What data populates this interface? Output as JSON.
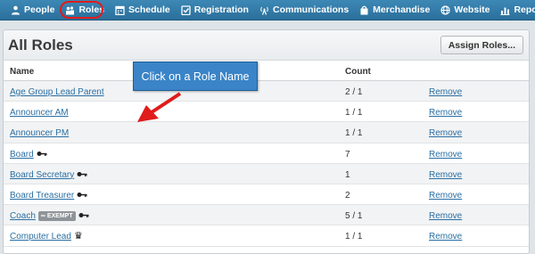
{
  "nav": {
    "items": [
      {
        "label": "People",
        "icon": "person-icon"
      },
      {
        "label": "Roles",
        "icon": "roles-icon"
      },
      {
        "label": "Schedule",
        "icon": "calendar-icon"
      },
      {
        "label": "Registration",
        "icon": "checkbox-icon"
      },
      {
        "label": "Communications",
        "icon": "broadcast-icon"
      },
      {
        "label": "Merchandise",
        "icon": "bag-icon"
      },
      {
        "label": "Website",
        "icon": "globe-icon"
      },
      {
        "label": "Reports",
        "icon": "bar-chart-icon"
      }
    ],
    "active": "Roles"
  },
  "panel": {
    "title": "All Roles",
    "assign_label": "Assign Roles..."
  },
  "table": {
    "headers": {
      "name": "Name",
      "count": "Count"
    },
    "rows": [
      {
        "name": "Age Group Lead Parent",
        "count": "2 / 1",
        "action": "Remove",
        "badges": []
      },
      {
        "name": "Announcer AM",
        "count": "1 / 1",
        "action": "Remove",
        "badges": []
      },
      {
        "name": "Announcer PM",
        "count": "1 / 1",
        "action": "Remove",
        "badges": []
      },
      {
        "name": "Board",
        "count": "7",
        "action": "Remove",
        "badges": [
          "key"
        ]
      },
      {
        "name": "Board Secretary",
        "count": "1",
        "action": "Remove",
        "badges": [
          "key"
        ]
      },
      {
        "name": "Board Treasurer",
        "count": "2",
        "action": "Remove",
        "badges": [
          "key"
        ]
      },
      {
        "name": "Coach",
        "count": "5 / 1",
        "action": "Remove",
        "badges": [
          "exempt",
          "key"
        ]
      },
      {
        "name": "Computer Lead",
        "count": "1 / 1",
        "action": "Remove",
        "badges": [
          "crown"
        ]
      }
    ],
    "exempt_label": "∞ EXEMPT"
  },
  "callout": {
    "text": "Click on a Role Name"
  },
  "colors": {
    "nav": "#2f77a6",
    "link": "#2a6fa3",
    "callout": "#3a84c7",
    "ring": "#e01b1b",
    "arrow": "#e01b1b"
  }
}
